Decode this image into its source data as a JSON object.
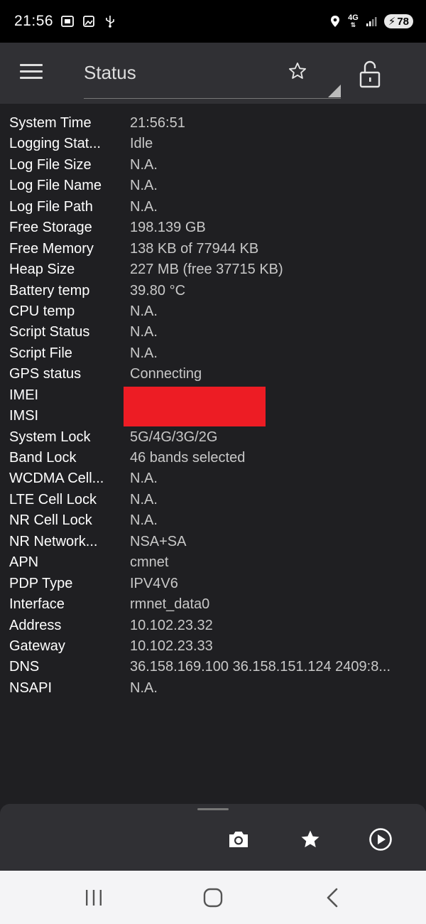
{
  "status_bar": {
    "time": "21:56",
    "network": "4G",
    "battery": "78",
    "icons": [
      "screenshot-icon",
      "gallery-icon",
      "usb-icon",
      "location-icon",
      "signal-icon",
      "battery-charging-icon"
    ]
  },
  "toolbar": {
    "title": "Status",
    "icons": [
      "menu-icon",
      "star-outline-icon",
      "lock-open-icon"
    ]
  },
  "status_rows": [
    {
      "label": "System Time",
      "value": "21:56:51"
    },
    {
      "label": "Logging Stat...",
      "value": "Idle"
    },
    {
      "label": "Log File Size",
      "value": "N.A."
    },
    {
      "label": "Log File Name",
      "value": "N.A."
    },
    {
      "label": "Log File Path",
      "value": "N.A."
    },
    {
      "label": "Free Storage",
      "value": "198.139 GB"
    },
    {
      "label": "Free Memory",
      "value": "138 KB of 77944 KB"
    },
    {
      "label": "Heap Size",
      "value": "227 MB (free 37715 KB)"
    },
    {
      "label": "Battery temp",
      "value": "39.80 °C"
    },
    {
      "label": "CPU temp",
      "value": "N.A."
    },
    {
      "label": "Script Status",
      "value": "N.A."
    },
    {
      "label": "Script File",
      "value": "N.A."
    },
    {
      "label": "GPS status",
      "value": "Connecting"
    },
    {
      "label": "IMEI",
      "value": ""
    },
    {
      "label": "IMSI",
      "value": ""
    },
    {
      "label": "System Lock",
      "value": "5G/4G/3G/2G"
    },
    {
      "label": "Band Lock",
      "value": "46 bands selected"
    },
    {
      "label": "WCDMA Cell...",
      "value": "N.A."
    },
    {
      "label": "LTE Cell Lock",
      "value": "N.A."
    },
    {
      "label": "NR Cell Lock",
      "value": "N.A."
    },
    {
      "label": "NR Network...",
      "value": "NSA+SA"
    },
    {
      "label": "APN",
      "value": "cmnet"
    },
    {
      "label": "PDP Type",
      "value": "IPV4V6"
    },
    {
      "label": "Interface",
      "value": "rmnet_data0"
    },
    {
      "label": "Address",
      "value": "10.102.23.32"
    },
    {
      "label": "Gateway",
      "value": "10.102.23.33"
    },
    {
      "label": "DNS",
      "value": "36.158.169.100 36.158.151.124 2409:8..."
    },
    {
      "label": "NSAPI",
      "value": "N.A."
    }
  ],
  "redaction_color": "#ed1c24",
  "bottom_actions": [
    "camera-icon",
    "star-filled-icon",
    "play-circle-icon"
  ],
  "nav_bar": [
    "recent-apps-icon",
    "home-icon",
    "back-icon"
  ]
}
